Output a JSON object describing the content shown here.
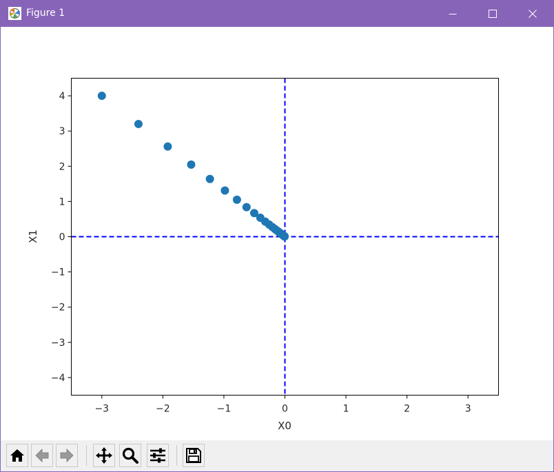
{
  "window": {
    "title": "Figure 1",
    "title_bar_color": "#8764b8",
    "icons": {
      "app": "matplotlib-figure-icon",
      "minimize": "minimize-icon",
      "maximize": "maximize-icon",
      "close": "close-icon"
    }
  },
  "toolbar": {
    "buttons": [
      {
        "name": "home",
        "icon": "home-icon"
      },
      {
        "name": "back",
        "icon": "arrow-left-icon"
      },
      {
        "name": "forward",
        "icon": "arrow-right-icon"
      },
      {
        "name": "pan",
        "icon": "move-icon"
      },
      {
        "name": "zoom",
        "icon": "magnifier-icon"
      },
      {
        "name": "configure-subplots",
        "icon": "sliders-icon"
      },
      {
        "name": "save",
        "icon": "save-icon"
      }
    ]
  },
  "chart_data": {
    "type": "scatter",
    "title": "",
    "xlabel": "X0",
    "ylabel": "X1",
    "xlim": [
      -3.5,
      3.5
    ],
    "ylim": [
      -4.5,
      4.5
    ],
    "xticks": [
      -3,
      -2,
      -1,
      0,
      1,
      2,
      3
    ],
    "yticks": [
      -4,
      -3,
      -2,
      -1,
      0,
      1,
      2,
      3,
      4
    ],
    "xtick_labels": [
      "−3",
      "−2",
      "−1",
      "0",
      "1",
      "2",
      "3"
    ],
    "ytick_labels": [
      "−4",
      "−3",
      "−2",
      "−1",
      "0",
      "1",
      "2",
      "3",
      "4"
    ],
    "grid": false,
    "marker_color": "#1f77b4",
    "points": [
      {
        "x": -3.0,
        "y": 4.0
      },
      {
        "x": -2.4,
        "y": 3.2
      },
      {
        "x": -1.92,
        "y": 2.56
      },
      {
        "x": -1.536,
        "y": 2.048
      },
      {
        "x": -1.229,
        "y": 1.638
      },
      {
        "x": -0.983,
        "y": 1.311
      },
      {
        "x": -0.786,
        "y": 1.049
      },
      {
        "x": -0.629,
        "y": 0.839
      },
      {
        "x": -0.503,
        "y": 0.671
      },
      {
        "x": -0.403,
        "y": 0.537
      },
      {
        "x": -0.322,
        "y": 0.429
      },
      {
        "x": -0.258,
        "y": 0.344
      },
      {
        "x": -0.206,
        "y": 0.275
      },
      {
        "x": -0.165,
        "y": 0.22
      },
      {
        "x": -0.132,
        "y": 0.176
      },
      {
        "x": -0.106,
        "y": 0.141
      },
      {
        "x": -0.084,
        "y": 0.113
      },
      {
        "x": -0.068,
        "y": 0.09
      },
      {
        "x": -0.054,
        "y": 0.072
      },
      {
        "x": -0.043,
        "y": 0.058
      },
      {
        "x": -0.035,
        "y": 0.046
      },
      {
        "x": -0.028,
        "y": 0.037
      },
      {
        "x": -0.022,
        "y": 0.03
      },
      {
        "x": -0.018,
        "y": 0.024
      },
      {
        "x": -0.014,
        "y": 0.019
      },
      {
        "x": -0.011,
        "y": 0.015
      },
      {
        "x": -0.009,
        "y": 0.012
      },
      {
        "x": -0.007,
        "y": 0.01
      },
      {
        "x": -0.006,
        "y": 0.008
      },
      {
        "x": -0.005,
        "y": 0.006
      }
    ],
    "reference_lines": [
      {
        "orientation": "vertical",
        "x": 0,
        "style": "dashed",
        "color": "#0000ff"
      },
      {
        "orientation": "horizontal",
        "y": 0,
        "style": "dashed",
        "color": "#0000ff"
      }
    ]
  }
}
